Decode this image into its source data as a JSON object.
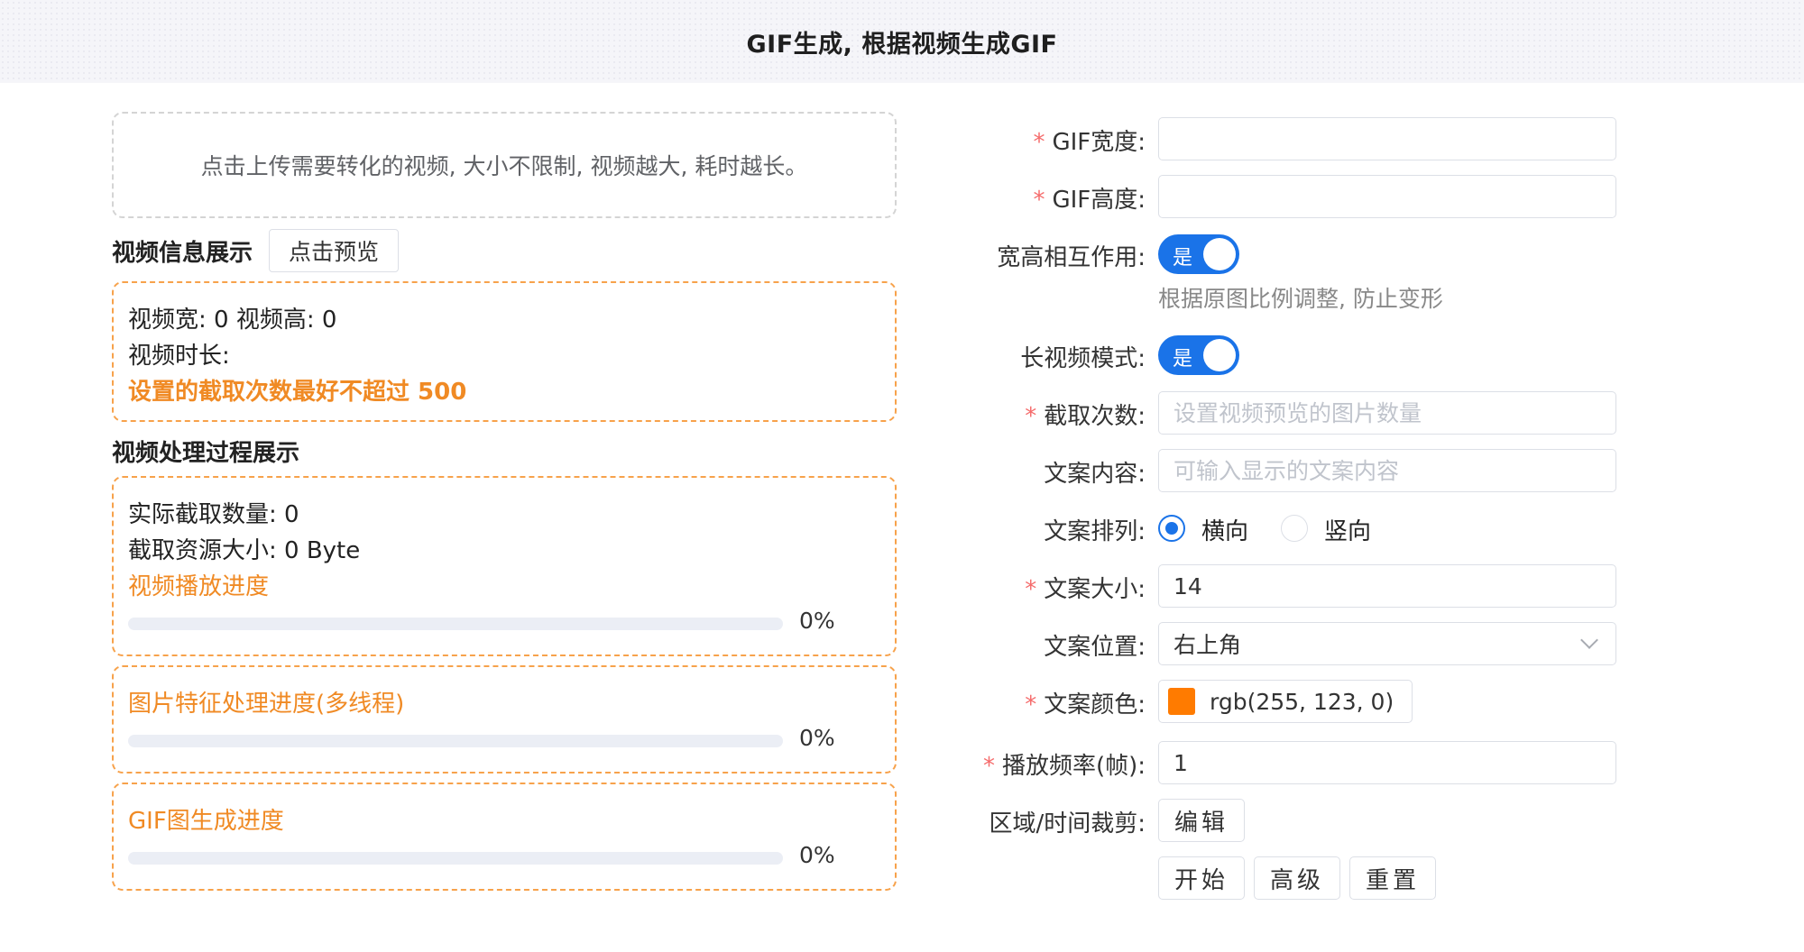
{
  "header": {
    "title": "GIF生成, 根据视频生成GIF"
  },
  "upload": {
    "text": "点击上传需要转化的视频, 大小不限制, 视频越大, 耗时越长。"
  },
  "video_info": {
    "title": "视频信息展示",
    "preview_button": "点击预览",
    "width_line": "视频宽: 0  视频高: 0",
    "duration_line": "视频时长:",
    "warning": "设置的截取次数最好不超过 500"
  },
  "process": {
    "title": "视频处理过程展示",
    "actual_count": "实际截取数量: 0",
    "resource_size": "截取资源大小: 0 Byte",
    "playback_label": "视频播放进度",
    "playback_percent": "0%",
    "playback_value": 0,
    "feature_label": "图片特征处理进度(多线程)",
    "feature_percent": "0%",
    "feature_value": 0,
    "gif_label": "GIF图生成进度",
    "gif_percent": "0%",
    "gif_value": 0
  },
  "form": {
    "gif_width": {
      "label": "GIF宽度:",
      "value": ""
    },
    "gif_height": {
      "label": "GIF高度:",
      "value": ""
    },
    "aspect_link": {
      "label": "宽高相互作用:",
      "switch_text": "是",
      "hint": "根据原图比例调整, 防止变形"
    },
    "long_video": {
      "label": "长视频模式:",
      "switch_text": "是"
    },
    "capture_count": {
      "label": "截取次数:",
      "placeholder": "设置视频预览的图片数量"
    },
    "text_content": {
      "label": "文案内容:",
      "placeholder": "可输入显示的文案内容"
    },
    "text_direction": {
      "label": "文案排列:",
      "options": [
        "横向",
        "竖向"
      ],
      "selected": "横向"
    },
    "text_size": {
      "label": "文案大小:",
      "value": "14"
    },
    "text_position": {
      "label": "文案位置:",
      "value": "右上角"
    },
    "text_color": {
      "label": "文案颜色:",
      "value": "rgb(255, 123, 0)",
      "swatch": "#ff7b00"
    },
    "frame_rate": {
      "label": "播放频率(帧):",
      "value": "1"
    },
    "crop": {
      "label": "区域/时间裁剪:",
      "button": "编辑"
    },
    "actions": {
      "start": "开始",
      "advanced": "高级",
      "reset": "重置"
    },
    "required_mark": "*"
  },
  "colors": {
    "accent": "#1a73e8",
    "orange": "#f08a24",
    "required": "#f56c6c"
  }
}
